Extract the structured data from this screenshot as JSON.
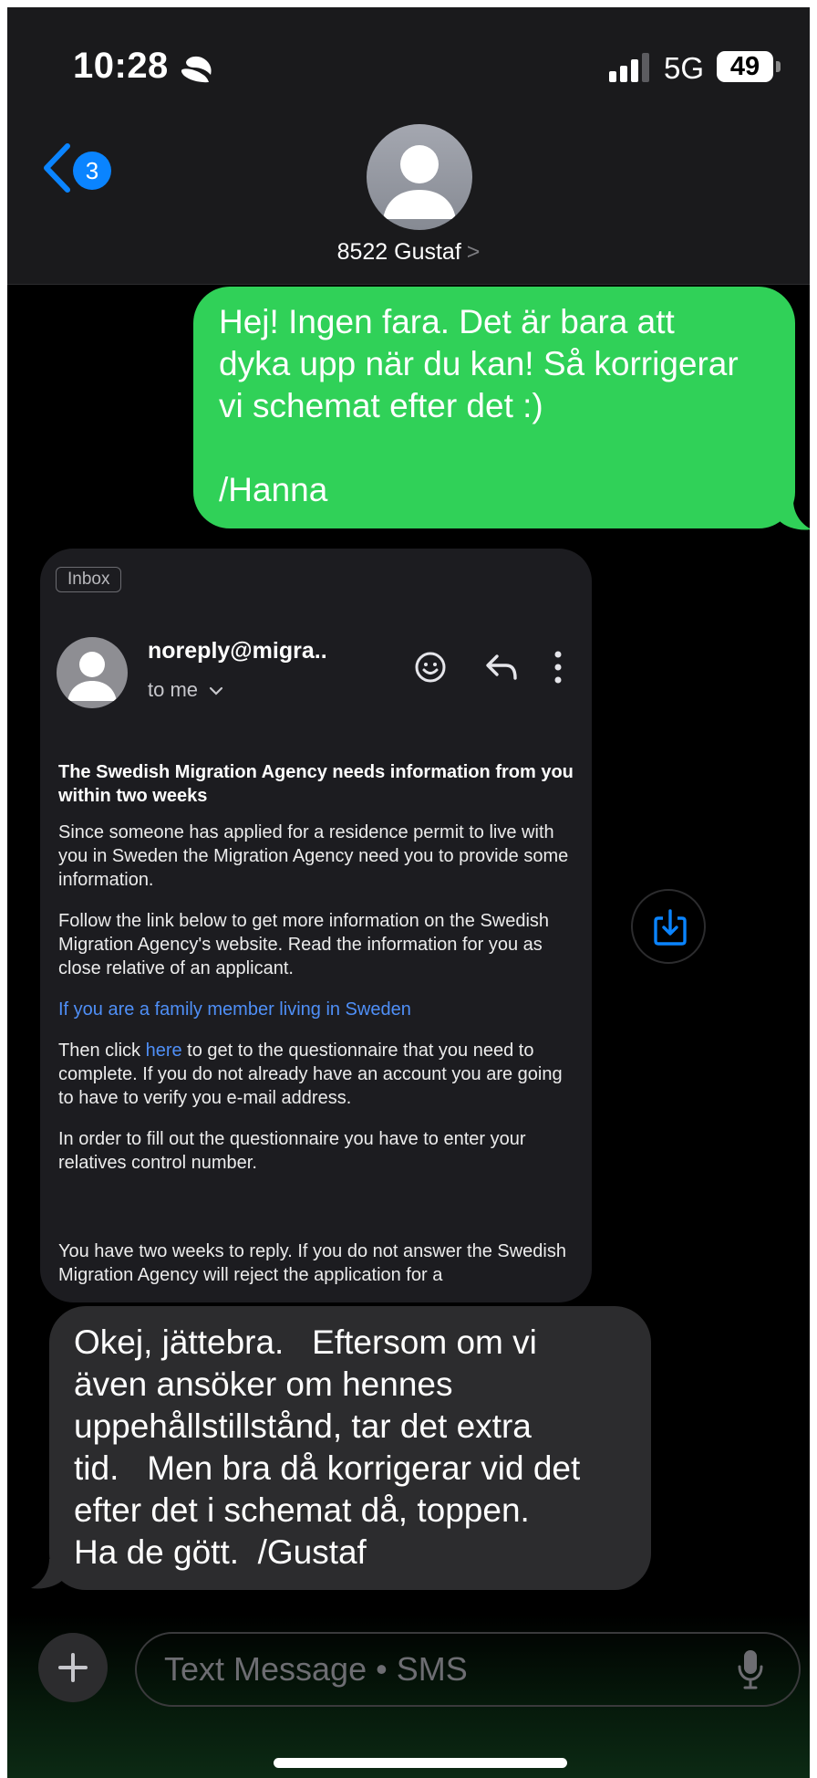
{
  "status_bar": {
    "time": "10:28",
    "network": "5G",
    "battery": "49"
  },
  "header": {
    "back_badge": "3",
    "contact_name": "8522 Gustaf",
    "contact_chevron": ">"
  },
  "messages": {
    "outgoing": "Hej! Ingen fara. Det är bara att\ndyka upp när du kan! Så korrigerar\nvi schemat efter det :)\n\n/Hanna",
    "incoming": "Okej, jättebra.   Eftersom om vi\näven ansöker om hennes\nuppehållstillstånd, tar det extra\ntid.   Men bra då korrigerar vid det\nefter det i schemat då, toppen.\nHa de gött.  /Gustaf"
  },
  "attachment": {
    "inbox_tag": "Inbox",
    "sender": "noreply@migra..",
    "to": "to me",
    "subject": "The Swedish Migration Agency needs information from you within two weeks",
    "para1": "Since someone has applied for a residence permit to live with you in Sweden the Migration Agency need you to provide some information.",
    "para2": "Follow the link below to get more information on the Swedish Migration Agency's website. Read the information for you as close relative of an applicant.",
    "link1": "If you are a family member living in Sweden",
    "para3_pre": "Then click ",
    "para3_link": "here",
    "para3_post": " to get to the questionnaire that you need to complete. If you do not already have an account you are going to have to verify you e-mail address.",
    "para4": "In order to fill out the questionnaire you have to enter your relatives control number.",
    "para5": "You have two weeks to reply. If you do not answer the Swedish Migration Agency will reject the application for a"
  },
  "input": {
    "placeholder": "Text Message • SMS"
  },
  "colors": {
    "outgoing_bubble": "#30d158",
    "incoming_bubble": "#2c2c2e",
    "accent": "#0a84ff",
    "email_link": "#4f8ff7"
  },
  "icons": [
    "moon-focus-icon",
    "signal-icon",
    "back-chevron-icon",
    "person-icon",
    "emoji-icon",
    "reply-icon",
    "more-vertical-icon",
    "save-download-icon",
    "plus-icon",
    "microphone-icon"
  ]
}
